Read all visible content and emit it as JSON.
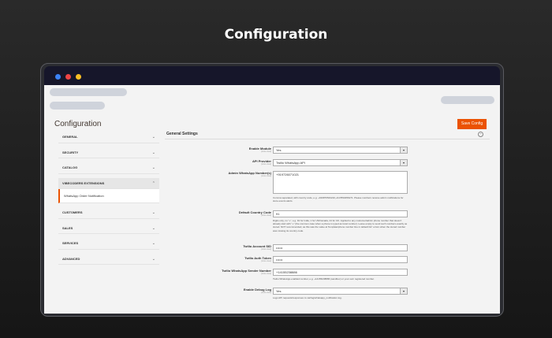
{
  "heading": "Configuration",
  "app": {
    "title": "Configuration",
    "save_label": "Save Config"
  },
  "nav": {
    "general": "GENERAL",
    "security": "SECURITY",
    "catalog": "CATALOG",
    "vendor": "VIBECODERS EXTENSIONS",
    "whatsapp": "WhatsApp Order Notification",
    "customers": "CUSTOMERS",
    "sales": "SALES",
    "services": "SERVICES",
    "advanced": "ADVANCED",
    "chev_down": "⌄",
    "chev_up": "⌃"
  },
  "section": {
    "title": "General Settings",
    "toggle": "⌃"
  },
  "scope_label": "[store view]",
  "fields": {
    "enable_module": {
      "label": "Enable Module",
      "value": "Yes"
    },
    "api_provider": {
      "label": "API Provider",
      "value": "Twilio WhatsApp API"
    },
    "admin_numbers": {
      "label": "Admin WhatsApp Number(s)",
      "value": "+919726071021",
      "note": "Comma separated, with country code, e.g. +919876543210,+917890456271. Please numbers receive admin notifications for store events alerts."
    },
    "country_code": {
      "label": "Default Country Code",
      "value": "91",
      "note": "Digits only, no \"+\", e.g. 91 for India, 1 for US/Canada, 44 for UK. Applied to any customer/admin phone number that doesn't already start with \"+\" (the common case when a phone is typed as local number). Leave empty to send such numbers exactly as stored.  NOT recommended, as this was the value at Template/phone number line in default list\" errors when the stored number was missing its country code."
    },
    "account_sid": {
      "label": "Twilio Account SID",
      "value": "••••••"
    },
    "auth_token": {
      "label": "Twilio Auth Token",
      "value": "••••••"
    },
    "sender_number": {
      "label": "Twilio WhatsApp Sender Number",
      "value": "+14155238886",
      "note": "Twilio WhatsApp-enabled number, e.g. +14155238886 (sandbox) or your own registered number."
    },
    "debug_log": {
      "label": "Enable Debug Log",
      "value": "Yes",
      "note": "Logs API requests/responses to var/log/whatsapp_notification.log."
    }
  },
  "select_arrow": "▾",
  "colors": {
    "accent": "#eb5202",
    "background": "#1e1e1e",
    "panel": "#f3f3f3"
  }
}
